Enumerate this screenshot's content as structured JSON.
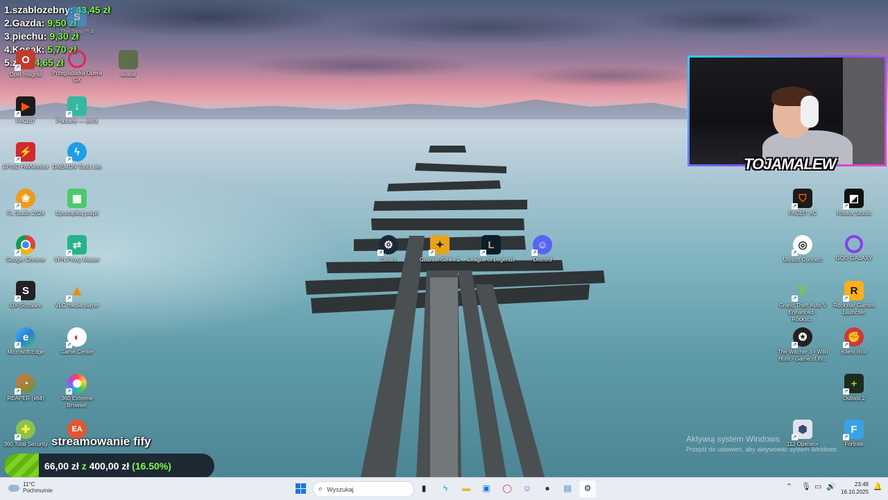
{
  "leaderboard": [
    {
      "rank_name": "1.szablozebny:",
      "amount": "43,45 zł"
    },
    {
      "rank_name": "2.Gazda:",
      "amount": "9,50 zł"
    },
    {
      "rank_name": "3.piechu:",
      "amount": "9,30 zł"
    },
    {
      "rank_name": "4.Kosak:",
      "amount": "5,70 zł"
    },
    {
      "rank_name": "5.zigi:",
      "amount": "4,65 zł"
    }
  ],
  "desktop_icons": {
    "opel": "Opel Insignia",
    "opera": "Przeglądarka Opera GX",
    "sims": "The Sims™ 4",
    "avatar": "avatar",
    "faceit": "FACEIT",
    "pobrane": "Pobrane — skrót",
    "cpuid": "CPUID HWMonitor",
    "daemon": "DAEMON Tools Lite",
    "flstudio": "FL Studio 2024",
    "uporzadkuj": "Uporządkuj pulpit",
    "chrome": "Google Chrome",
    "vpn": "VPN Proxy Master",
    "lix": "LIX-Software",
    "vlc": "VLC media player",
    "edge": "Microsoft Edge",
    "gamecenter": "Game Center",
    "reaper": "REAPER (x64)",
    "browser360": "360 Extreme Browser",
    "security360": "360 Total Security",
    "ea": "EA",
    "steam": "Steam",
    "cs2": "Counter-Strike 2",
    "lol": "League of Legends",
    "discord": "Discord",
    "faceitac": "FACEIT AC",
    "roblox": "Roblox Studio",
    "ubisoft": "Ubisoft Connect",
    "gog": "GOG GALAXY",
    "gta": "Grand Theft Auto V Enhanced - Rockst...",
    "rockstar": "Rockstar Games Launcher",
    "witcher": "The Witcher 3 - Wild Hunt - Game of th...",
    "riot": "Klient Riot",
    "outlast": "Outlast 2",
    "r6": "112 Operator",
    "fortnite": "Fortnite"
  },
  "stream": {
    "streamer_name": "TOJAMALEW",
    "goal_title": "streamowanie fify",
    "goal_current": "66,00 zł",
    "goal_separator": "z",
    "goal_target": "400,00 zł",
    "goal_percent": "(16.50%)",
    "goal_fraction": 0.165
  },
  "activation": {
    "title": "Aktywuj system Windows",
    "subtitle": "Przejdź do ustawień, aby aktywować system Windows."
  },
  "taskbar": {
    "weather_temp": "11°C",
    "weather_cond": "Pochmurnie",
    "search_placeholder": "Wyszukaj",
    "time": "23:49",
    "date": "16.10.2025"
  },
  "colors": {
    "accent_green": "#7CFC3A",
    "taskbar_bg": "#e8edf3",
    "start_blue": "#1a73e8"
  }
}
